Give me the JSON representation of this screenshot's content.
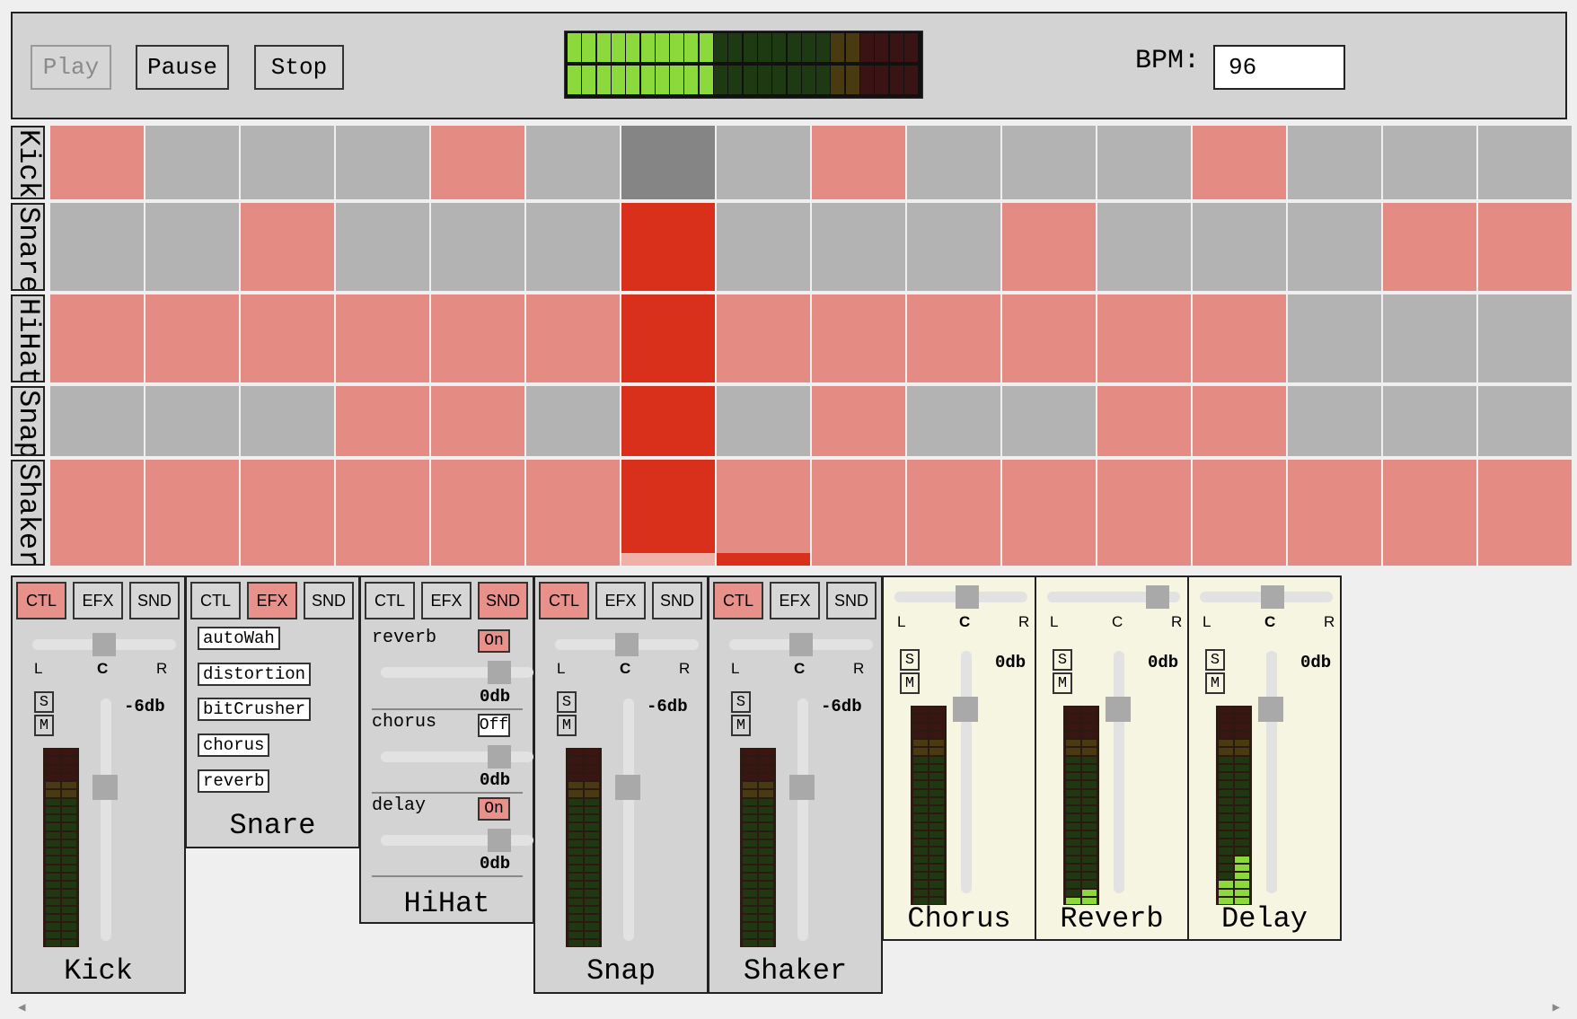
{
  "transport": {
    "play_label": "Play",
    "pause_label": "Pause",
    "stop_label": "Stop",
    "bpm_label": "BPM:",
    "bpm_value": "96",
    "master_level": {
      "left": 0.43,
      "right": 0.41
    }
  },
  "sequencer": {
    "playhead_step": 7,
    "colors": {
      "on": "#e48c84",
      "off": "#b3b3b3",
      "playhead_on": "#d9301c",
      "playhead_off": "#858585"
    },
    "lanes": [
      {
        "name": "Kick",
        "steps": [
          1,
          0,
          0,
          0,
          1,
          0,
          0,
          0,
          1,
          0,
          0,
          0,
          1,
          0,
          0,
          0
        ]
      },
      {
        "name": "Snare",
        "steps": [
          0,
          0,
          1,
          0,
          0,
          0,
          1,
          0,
          0,
          0,
          1,
          0,
          0,
          0,
          1,
          1
        ]
      },
      {
        "name": "HiHat",
        "steps": [
          1,
          1,
          1,
          1,
          1,
          1,
          1,
          1,
          1,
          1,
          1,
          1,
          1,
          0,
          0,
          0
        ]
      },
      {
        "name": "Snap",
        "steps": [
          0,
          0,
          0,
          1,
          1,
          0,
          1,
          0,
          1,
          0,
          0,
          1,
          1,
          0,
          0,
          0
        ]
      },
      {
        "name": "Shaker",
        "steps": [
          1,
          1,
          1,
          1,
          1,
          1,
          1,
          1,
          1,
          1,
          1,
          1,
          1,
          1,
          1,
          1
        ]
      }
    ]
  },
  "tabs": {
    "ctl": "CTL",
    "efx": "EFX",
    "snd": "SND"
  },
  "pan": {
    "l": "L",
    "c": "C",
    "r": "R"
  },
  "solo_label": "S",
  "mute_label": "M",
  "channels": {
    "kick": {
      "name": "Kick",
      "active_tab": "CTL",
      "gain": "-6db",
      "pan": 0.5
    },
    "snare": {
      "name": "Snare",
      "active_tab": "EFX",
      "effects": [
        "autoWah",
        "distortion",
        "bitCrusher",
        "chorus",
        "reverb"
      ]
    },
    "hihat": {
      "name": "HiHat",
      "active_tab": "SND",
      "sends": [
        {
          "name": "reverb",
          "state": "On",
          "level": "0db"
        },
        {
          "name": "chorus",
          "state": "Off",
          "level": "0db"
        },
        {
          "name": "delay",
          "state": "On",
          "level": "0db"
        }
      ]
    },
    "snap": {
      "name": "Snap",
      "active_tab": "CTL",
      "gain": "-6db",
      "pan": 0.5
    },
    "shaker": {
      "name": "Shaker",
      "active_tab": "CTL",
      "gain": "-6db",
      "pan": 0.5
    }
  },
  "returns": {
    "chorus": {
      "name": "Chorus",
      "gain": "0db",
      "meter_level": 0.0
    },
    "reverb": {
      "name": "Reverb",
      "gain": "0db",
      "meter_level": 0.12
    },
    "delay": {
      "name": "Delay",
      "gain": "0db",
      "meter_level": 0.25
    }
  },
  "icons": {
    "scroll_left": "triangle-left-icon",
    "scroll_right": "triangle-right-icon"
  }
}
